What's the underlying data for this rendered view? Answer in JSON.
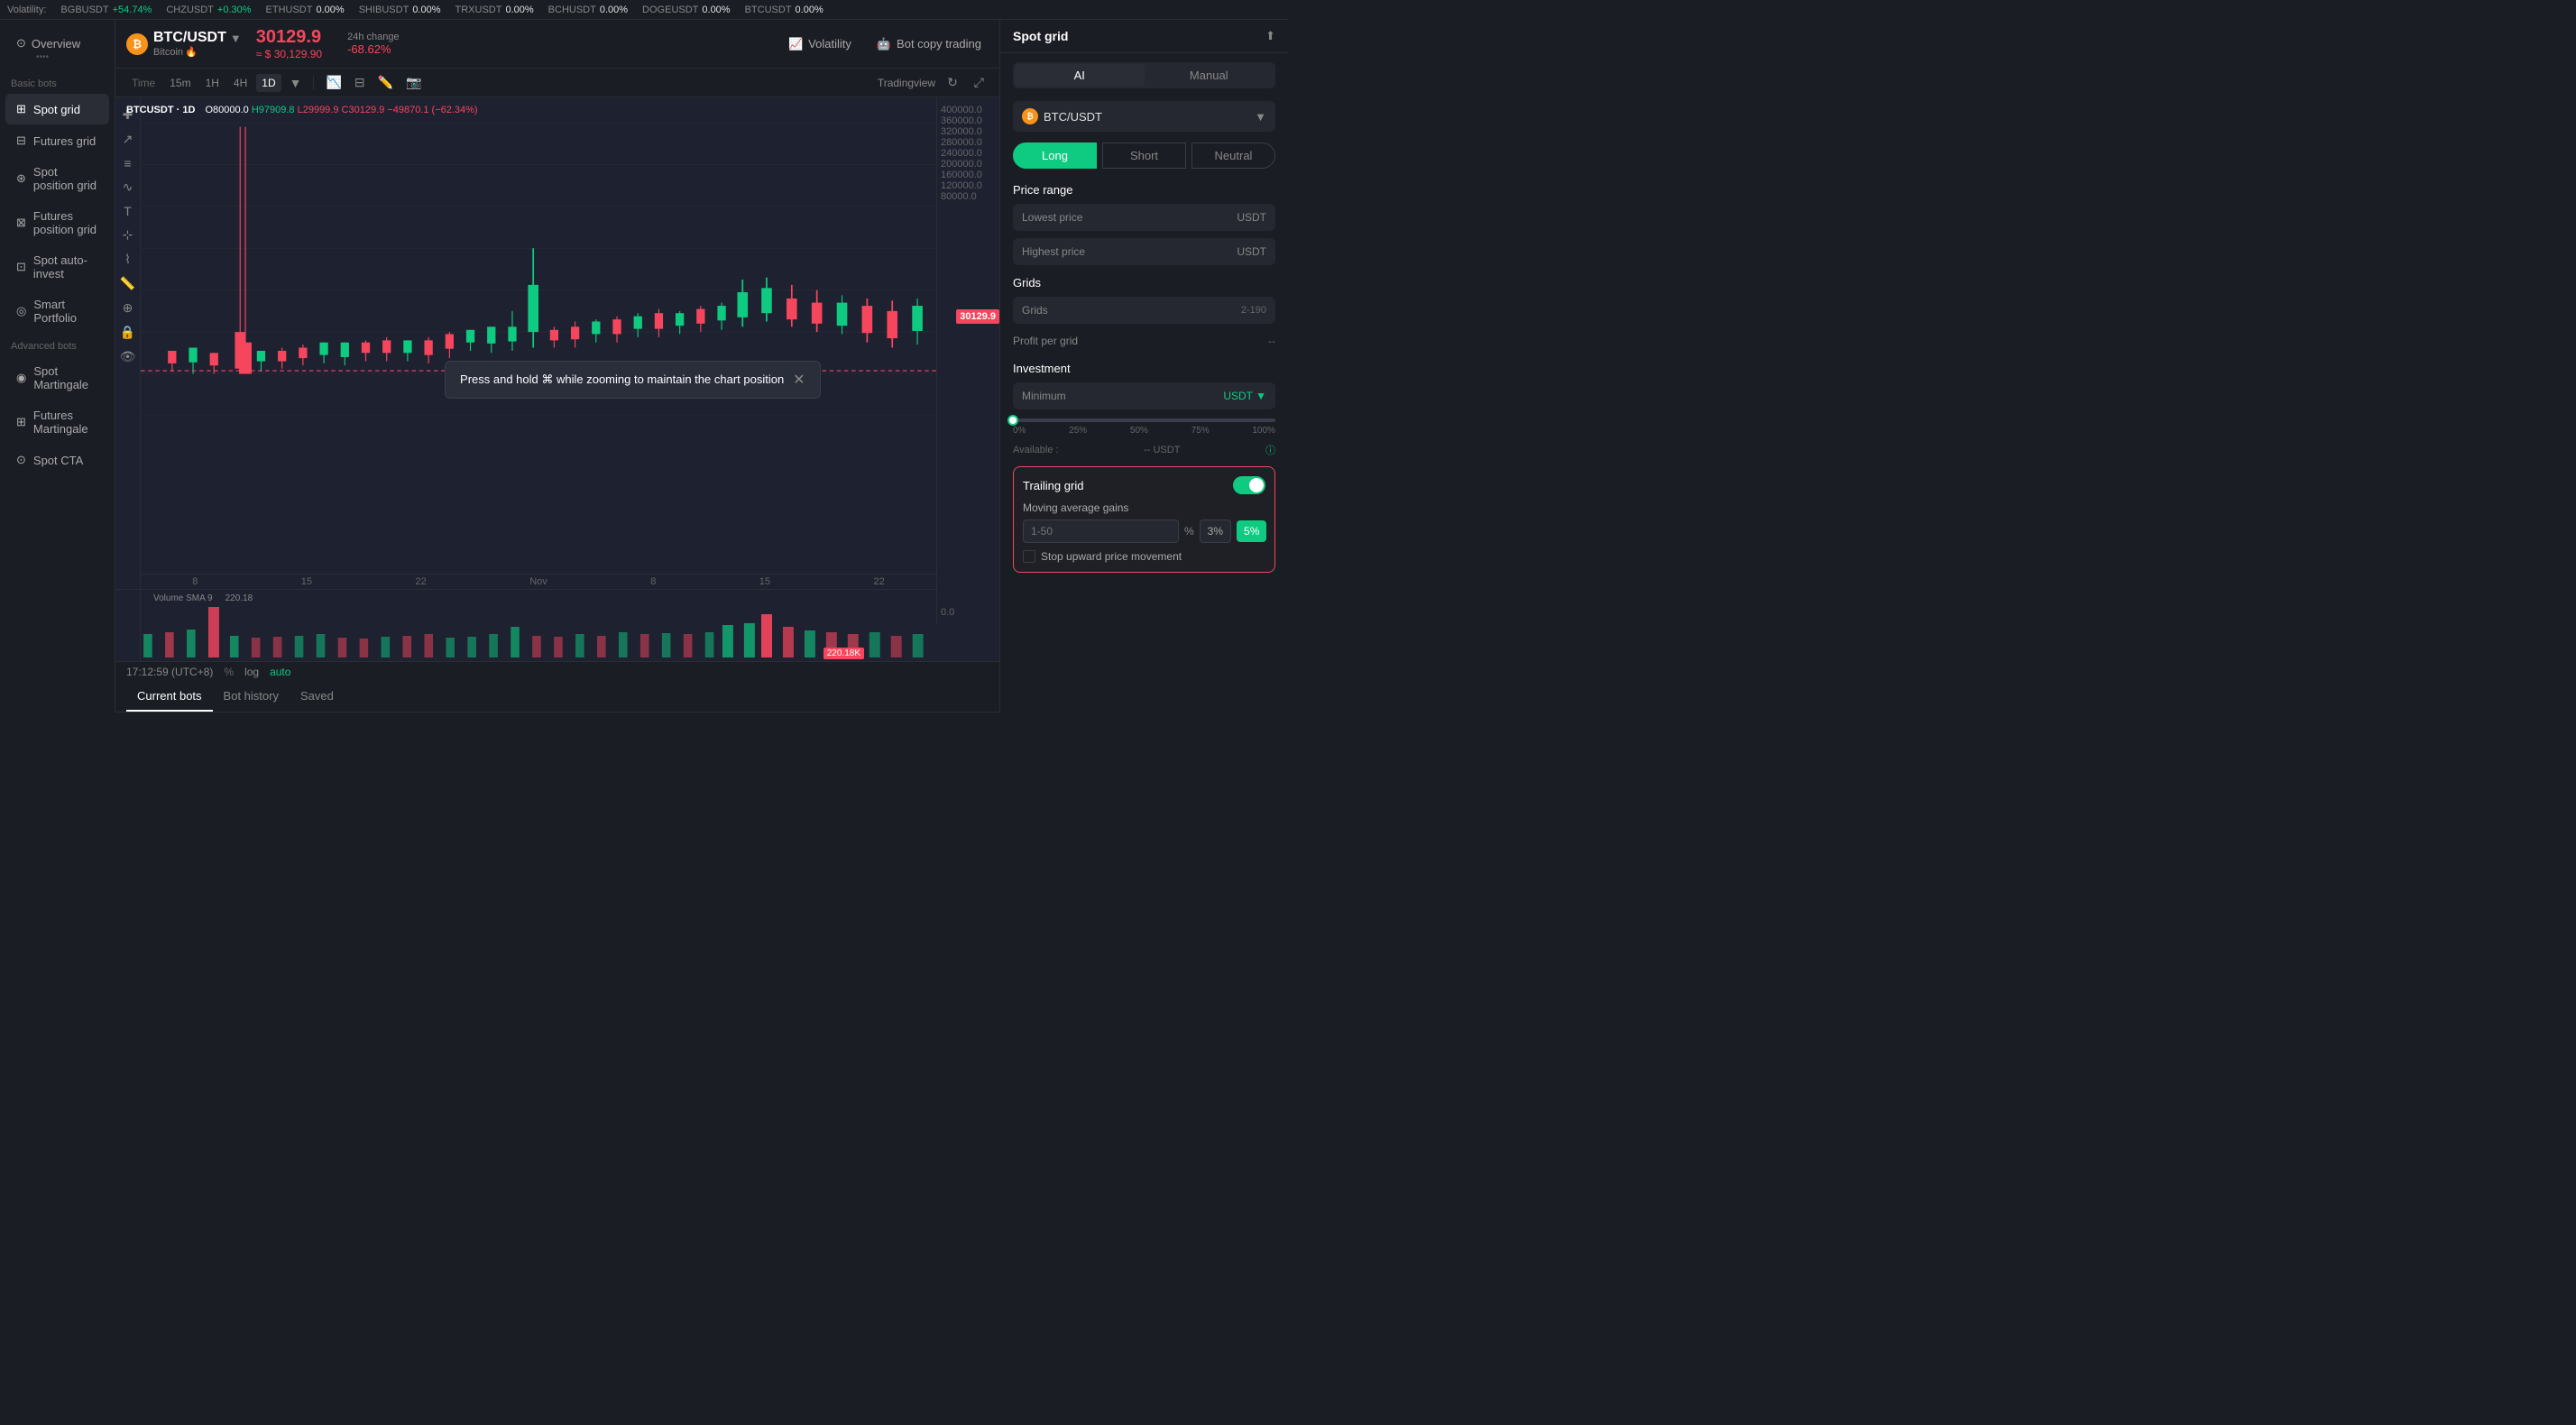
{
  "ticker": {
    "label": "Volatility:",
    "items": [
      {
        "pair": "BGBUSDT",
        "change": "+54.74%",
        "direction": "up"
      },
      {
        "pair": "CHZUSDT",
        "change": "+0.30%",
        "direction": "up"
      },
      {
        "pair": "ETHUSDT",
        "change": "0.00%",
        "direction": "neutral"
      },
      {
        "pair": "SHIBUSDT",
        "change": "0.00%",
        "direction": "neutral"
      },
      {
        "pair": "TRXUSDT",
        "change": "0.00%",
        "direction": "neutral"
      },
      {
        "pair": "BCHUSDT",
        "change": "0.00%",
        "direction": "neutral"
      },
      {
        "pair": "DOGEUSDT",
        "change": "0.00%",
        "direction": "neutral"
      },
      {
        "pair": "BTCUSDT",
        "change": "0.00%",
        "direction": "neutral"
      }
    ]
  },
  "sidebar": {
    "overview_label": "Overview",
    "overview_dots": "••••",
    "basic_bots_label": "Basic bots",
    "items": [
      {
        "id": "spot-grid",
        "label": "Spot grid",
        "active": true
      },
      {
        "id": "futures-grid",
        "label": "Futures grid"
      },
      {
        "id": "spot-position-grid",
        "label": "Spot position grid"
      },
      {
        "id": "futures-position-grid",
        "label": "Futures position grid"
      },
      {
        "id": "spot-auto-invest",
        "label": "Spot auto-invest"
      },
      {
        "id": "smart-portfolio",
        "label": "Smart Portfolio"
      }
    ],
    "advanced_bots_label": "Advanced bots",
    "advanced_items": [
      {
        "id": "spot-martingale",
        "label": "Spot Martingale"
      },
      {
        "id": "futures-martingale",
        "label": "Futures Martingale"
      },
      {
        "id": "spot-cta",
        "label": "Spot CTA"
      }
    ]
  },
  "chart": {
    "pair": "BTC/USDT",
    "coin_name": "Bitcoin",
    "fire_emoji": "🔥",
    "price_main": "30129.9",
    "price_sub": "≈ $ 30,129.90",
    "change_label": "24h change",
    "change_val": "-68.62%",
    "ohlc_label": "BTCUSDT · 1D",
    "ohlc_o": "O80000.0",
    "ohlc_h": "H97909.8",
    "ohlc_l": "L29999.9",
    "ohlc_c": "C30129.9",
    "ohlc_change": "-49870.1 (-62.34%)",
    "current_price": "30129.9",
    "price_levels": [
      "400000.0",
      "360000.0",
      "320000.0",
      "280000.0",
      "240000.0",
      "200000.0",
      "160000.0",
      "120000.0",
      "80000.0",
      "0.0"
    ],
    "x_labels": [
      "8",
      "15",
      "22",
      "Nov",
      "8",
      "15",
      "22"
    ],
    "volume_label": "Volume SMA 9",
    "volume_val": "220.18",
    "volume_badge": "220.18K",
    "time_display": "17:12:59 (UTC+8)",
    "time_buttons": [
      "15m",
      "1H",
      "4H",
      "1D"
    ],
    "active_time": "1D",
    "tradingview_label": "Tradingview",
    "volatility_btn": "Volatility",
    "bot_copy_trading_btn": "Bot copy trading",
    "tooltip_text": "Press and hold ⌘ while zooming to maintain the chart position",
    "tabs": [
      "Current bots",
      "Bot history",
      "Saved"
    ],
    "active_tab": "Current bots"
  },
  "right_panel": {
    "title": "Spot grid",
    "mode_ai": "AI",
    "mode_manual": "Manual",
    "active_mode": "AI",
    "pair": "BTC/USDT",
    "directions": [
      "Long",
      "Short",
      "Neutral"
    ],
    "active_direction": "Long",
    "price_range_label": "Price range",
    "lowest_price_placeholder": "Lowest price",
    "lowest_suffix": "USDT",
    "highest_price_placeholder": "Highest price",
    "highest_suffix": "USDT",
    "grids_label": "Grids",
    "grids_placeholder": "Grids",
    "grids_range": "2-190",
    "profit_label": "Profit per grid",
    "profit_val": "--",
    "investment_label": "Investment",
    "minimum_placeholder": "Minimum",
    "inv_suffix": "USDT",
    "slider_pcts": [
      "0%",
      "25%",
      "50%",
      "75%",
      "100%"
    ],
    "available_label": "Available :",
    "available_val": "-- USDT",
    "trailing_section": {
      "label": "Trailing grid",
      "toggle_on": true,
      "ma_label": "Moving average gains",
      "ma_placeholder": "1-50",
      "ma_pct": "%",
      "ma_val1": "3%",
      "ma_val2": "5%",
      "stop_label": "Stop upward price movement"
    }
  }
}
